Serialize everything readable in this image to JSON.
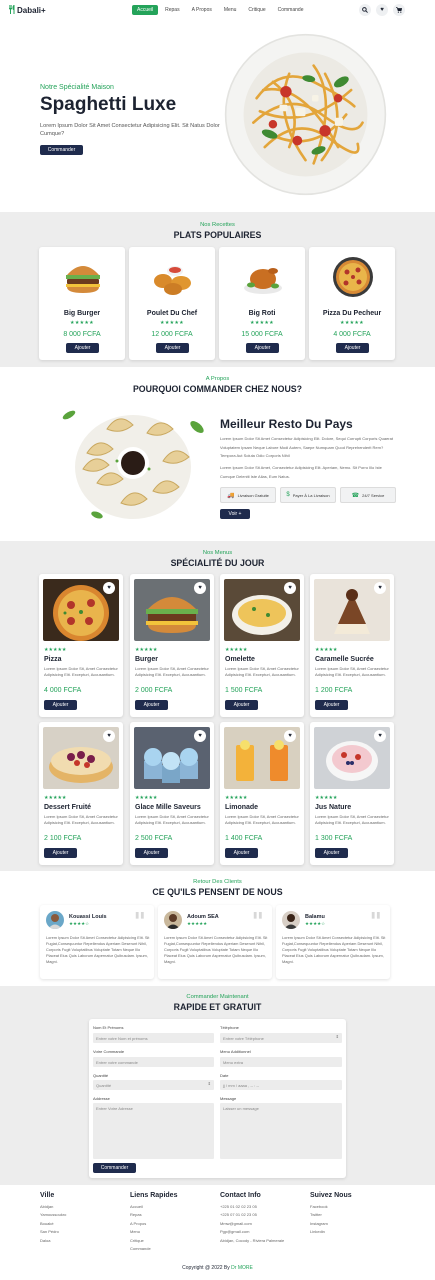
{
  "nav": {
    "logo": "Dabali+",
    "items": [
      "Accueil",
      "Repas",
      "A Propos",
      "Menu",
      "Critique",
      "Commande"
    ],
    "active_index": 0,
    "icons": [
      "search-icon",
      "heart-icon",
      "cart-icon"
    ]
  },
  "hero": {
    "subtitle": "Notre Spécialité Maison",
    "title": "Spaghetti Luxe",
    "text": "Lorem Ipsum Dolor Sit Amet Consectetur Adipisicing Elit. Sit Natus Dolor Cumque?",
    "button": "Commander"
  },
  "popular": {
    "subtitle": "Nos Recettes",
    "title": "PLATS POPULAIRES",
    "items": [
      {
        "name": "Big Burger",
        "stars": "★★★★★",
        "price": "8 000 FCFA",
        "button": "Ajouter"
      },
      {
        "name": "Poulet Du Chef",
        "stars": "★★★★★",
        "price": "12 000 FCFA",
        "button": "Ajouter"
      },
      {
        "name": "Big Roti",
        "stars": "★★★★★",
        "price": "15 000 FCFA",
        "button": "Ajouter"
      },
      {
        "name": "Pizza Du Pecheur",
        "stars": "★★★★★",
        "price": "4 000 FCFA",
        "button": "Ajouter"
      }
    ]
  },
  "about": {
    "subtitle": "A Propos",
    "title": "POURQUOI COMMANDER CHEZ NOUS?",
    "heading": "Meilleur Resto Du Pays",
    "p1": "Lorem Ipsum Dolor Sit Amet Consectetur Adipisicing Elit. Dolore, Sequi Corrupti Corporis Quaerat Voluptatem Ipsam Neque Labore Modi Autem, Saepe Numquam Quod Reprehenderit Rem? Tempora Aut Soluta Odio Corporis Nihil",
    "p2": "Lorem Ipsum Dolor Sit Amet, Consectetur Adipisicing Elit. Aperiam, Nemo. Sit Porro Illo Iste Cumque Deleniti Iste Alias, Eum Natus.",
    "features": [
      "Livraison Gratuite",
      "Payer À La Livraison",
      "24/7 Service"
    ],
    "button": "Voir +"
  },
  "specials": {
    "subtitle": "Nos Menus",
    "title": "SPÉCIALITÉ DU JOUR",
    "desc": "Lorem Ipsum Dolor Sit, Amet Consectetur Adipisicing Elit. Excepturi, Accusantium.",
    "items": [
      {
        "name": "Pizza",
        "price": "4 000 FCFA"
      },
      {
        "name": "Burger",
        "price": "2 000 FCFA"
      },
      {
        "name": "Omelette",
        "price": "1 500 FCFA"
      },
      {
        "name": "Caramelle Sucrée",
        "price": "1 200 FCFA"
      },
      {
        "name": "Dessert Fruité",
        "price": "2 100 FCFA"
      },
      {
        "name": "Glace Mille Saveurs",
        "price": "2 500 FCFA"
      },
      {
        "name": "Limonade",
        "price": "1 400 FCFA"
      },
      {
        "name": "Jus Nature",
        "price": "1 300 FCFA"
      }
    ],
    "stars": "★★★★★",
    "button": "Ajouter"
  },
  "reviews": {
    "subtitle": "Retour Des Clients",
    "title": "CE QU'ILS PENSENT DE NOUS",
    "text": "Lorem Ipsum Dolor Sit Amet Consectetur Adipisicing Elit. Sit Fugiat,Consequuntur Repellendus Aperiam Deserunt Nihil, Corporis Fugit Voluptatibus Voluptate Totam Neque Illo Placeat Eius Quis Laborum Aspernatur Quibusdam. Ipsum, Magni.",
    "items": [
      {
        "name": "Kouassi Louis",
        "stars": "★★★★☆"
      },
      {
        "name": "Adoum SEA",
        "stars": "★★★★★"
      },
      {
        "name": "Balamu",
        "stars": "★★★★☆"
      }
    ]
  },
  "order": {
    "subtitle": "Commander Maintenant",
    "title": "RAPIDE ET GRATUIT",
    "fields": {
      "name_label": "Nom Et Prénoms",
      "name_ph": "Entrer votre Nom et prénoms",
      "phone_label": "Téléphone",
      "phone_ph": "Entrer votre Téléphone",
      "cmd_label": "Votre Commande",
      "cmd_ph": "Entrer votre commande",
      "extra_label": "Menu Additionnel",
      "extra_ph": "Menu extra",
      "qty_label": "Quantité",
      "qty_ph": "Quantité",
      "date_label": "Date",
      "date_ph": "jj / mm / aaaa ,  -- : --",
      "addr_label": "Addresse",
      "addr_ph": "Entrer Votre Adresse",
      "msg_label": "Message",
      "msg_ph": "Laisser un message"
    },
    "button": "Commander"
  },
  "footer": {
    "cols": [
      {
        "title": "Ville",
        "links": [
          "Abidjan",
          "Yamoussoukro",
          "Bouaké",
          "San Pédro",
          "Daloa"
        ]
      },
      {
        "title": "Liens Rapides",
        "links": [
          "Accueil",
          "Repas",
          "A Propos",
          "Menu",
          "Critique",
          "Commande"
        ]
      },
      {
        "title": "Contact Info",
        "links": [
          "+225 01 02 02 23 05",
          "+225 07 01 02 23 05",
          "Mmw@gmail.com",
          "Pgp@gmail.com",
          "Abidjan, Cocody - Riviera Palmeraie"
        ]
      },
      {
        "title": "Suivez Nous",
        "links": [
          "Facebook",
          "Twitter",
          "Instagram",
          "Linkedin"
        ]
      }
    ],
    "copyright_prefix": "Copyright @ 2022 By ",
    "copyright_brand": "Dr MORE"
  },
  "colors": {
    "accent": "#24a35a",
    "navy": "#1f2b4d",
    "band": "#ededed"
  }
}
